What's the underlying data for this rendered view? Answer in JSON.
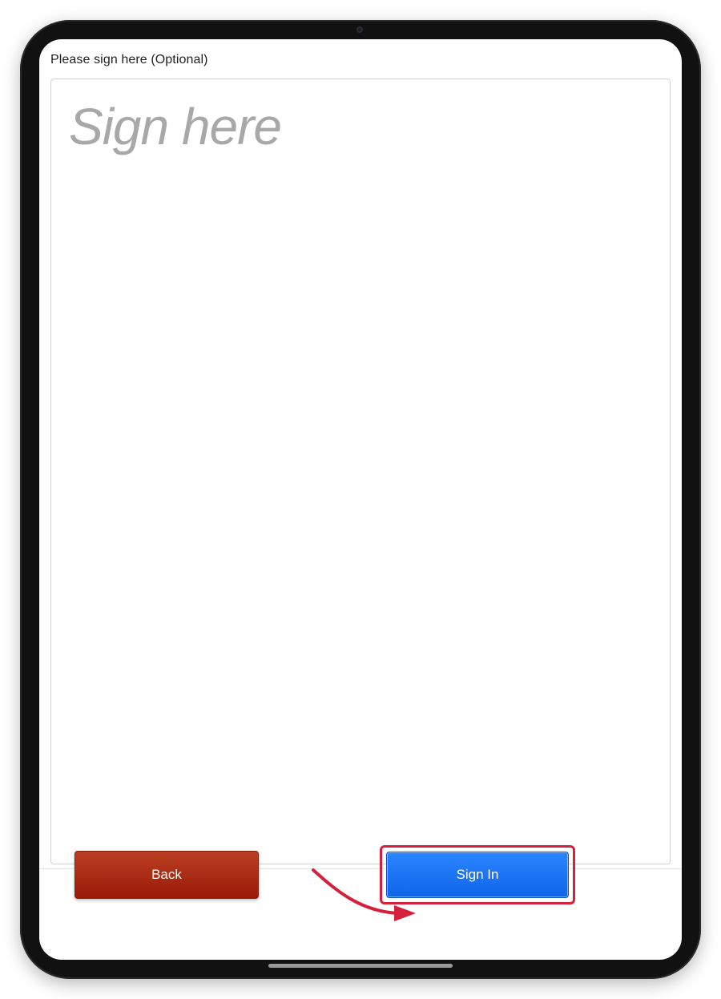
{
  "signature": {
    "label": "Please sign here (Optional)",
    "placeholder": "Sign here"
  },
  "actions": {
    "back_label": "Back",
    "sign_in_label": "Sign In"
  },
  "colors": {
    "back_button": "#a82710",
    "sign_in_button": "#1473f5",
    "highlight": "#d61f3a"
  },
  "icons": {
    "annotation": "curved-arrow-icon"
  }
}
